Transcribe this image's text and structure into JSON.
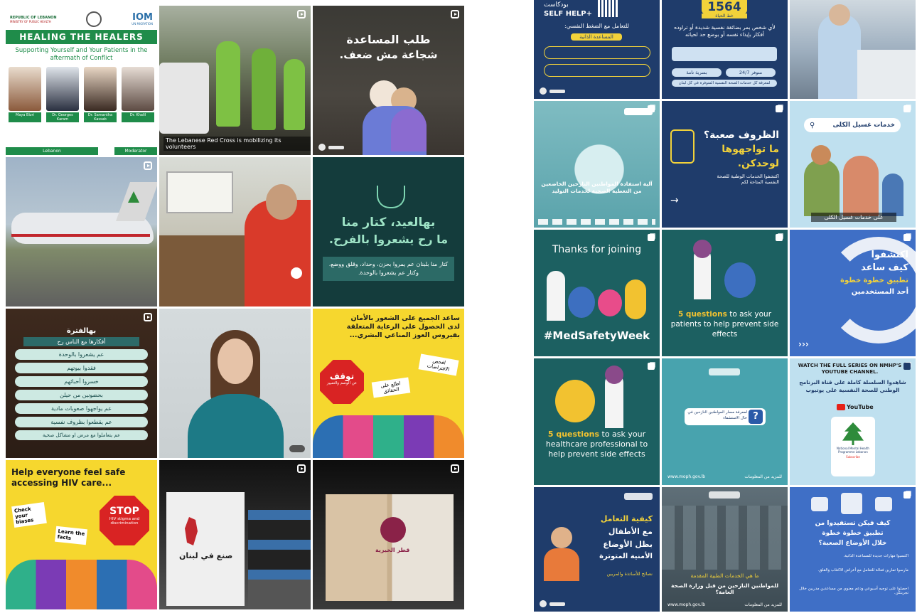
{
  "left": {
    "t1": {
      "org_left": "REPUBLIC OF LEBANON",
      "org_left_sub": "MINISTRY OF PUBLIC HEALTH",
      "org_right": "IOM",
      "org_right_sub": "UN MIGRATION",
      "banner": "HEALING THE HEALERS",
      "subtitle": "Supporting Yourself and Your Patients in the aftermath of Conflict",
      "speakers": [
        "Maya Bizri",
        "Dr. Georges Karam",
        "Dr. Samantha Kassab",
        "Dr. Khalil"
      ],
      "footer_left": "Lebanon",
      "footer_right": "Moderator"
    },
    "t2": {
      "caption": "The Lebanese Red Cross is mobilizing its volunteers"
    },
    "t3": {
      "line1": "طلب المساعدة",
      "line2": "شجاعة مش ضعف."
    },
    "t5": {},
    "t6": {},
    "t7": {
      "line1": "بهالعيد، كتار منا",
      "line2": "ما رح يشعروا بالفرح.",
      "body": "كتار منا بلبنان عم يمروا بحزن، وحداد، وقلق ووضع، وكتار عم يشعروا بالوحدة."
    },
    "t8": {
      "title": "بهالفترة",
      "subtitle": "أفكارها مع الناس رح",
      "items": [
        "عم يشعروا بالوحدة",
        "فقدوا بيوتهم",
        "خسروا أحبائهم",
        "بحضونين من حيلن",
        "عم يواجهوا صعوبات مادية",
        "عم يقطعوا بظروف نفسية",
        "عم يتعاملوا مع مرض او مشاكل صحية"
      ]
    },
    "t9": {},
    "t10": {
      "line1": "ساعد الجميع على الشعور بالأمان",
      "line2": "لدى الحصول على الرعاية المتعلقة",
      "line3": "بفيروس العوز المناعي البشري...",
      "sign1": "توقف",
      "sign1_sub": "عن الوصم والتمييز",
      "sign2": "اطلع على الحقائق",
      "sign3": "افحص الافتراضات"
    },
    "t11": {
      "title_line1": "Help everyone feel safe",
      "title_line2": "accessing HIV care...",
      "sign1": "Check your biases",
      "sign2": "Learn the facts",
      "stop": "STOP",
      "stop_sub": "HIV stigma and discrimination"
    },
    "t12": {
      "box_text": "صنع في لبنان"
    },
    "t13": {
      "box_text": "قطر الخيرية"
    }
  },
  "right": {
    "r1": {
      "title": "SELF HELP+",
      "title_top": "بودكاست",
      "line": "للتعامل مع الضغط النفسي:",
      "pill": "المساعدة الذاتية"
    },
    "r2": {
      "number": "1564",
      "number_sub": "خط الحياة",
      "body": "لأي شخص بمر بضائقة نفسية شديدة أو تراوده أفكار بإيذاء نفسه أو بوضع حد لحياته",
      "pill1": "متوفر 24/7",
      "pill2": "بسرية تامة",
      "footer": "لمعرفة كل خدمات الصحة النفسية المتوفرة في كل لبنان"
    },
    "r4": {
      "body": "آلية استفادة المواطنين النازحين الخاضعين من التغطية الصحية لخدمات التوليد"
    },
    "r5": {
      "line1": "الظروف صعبة؟",
      "line2": "ما تواجهوها",
      "line3": "لوحدكن.",
      "sub": "اكتشفوا الخدمات الوطنية للصحة النفسية المتاحة لكم"
    },
    "r6": {
      "search": "خدمات غسيل الكلى",
      "caption": "على خدمات غسيل الكلى"
    },
    "r7": {
      "top": "Thanks for joining",
      "tag": "#MedSafetyWeek"
    },
    "r8": {
      "hl": "5 questions",
      "rest": "to ask your patients to help prevent side effects"
    },
    "r9": {
      "line1": "اكتشفوا",
      "line2": "كيف ساعد",
      "line3": "تطبيق خطوة خطوة",
      "line4": "أحد المستخدمين"
    },
    "r10": {
      "hl": "5 questions",
      "rest": "to ask your healthcare professional to help prevent side effects"
    },
    "r11": {
      "card": "لمعرفة مسار المواطنين النازحين في حال الاستشفاء",
      "footer_left": "www.moph.gov.lb",
      "footer_right": "للمزيد من المعلومات"
    },
    "r12": {
      "en": "WATCH THE FULL SERIES ON NMHP'S YOUTUBE CHANNEL.",
      "ar": "شاهدوا السلسلة كاملة على قناة البرنامج الوطني للصحة النفسية على يوتيوب",
      "yt": "YouTube",
      "card": "National Mental Health Programme Lebanon",
      "subscribe": "Subscribe"
    },
    "r13": {
      "line1": "كيفية التعامل",
      "line2": "مع الأطفال",
      "line3": "بظل الأوضاع",
      "line4": "الأمنية المتوترة",
      "sub": "نصائح للأساتذة والمربين"
    },
    "r14": {
      "line1": "ما هي الخدمات الطبية المقدمة",
      "line2": "للمواطنين النازحين من قبل وزارة الصحة العامة؟",
      "footer_left": "www.moph.gov.lb",
      "footer_right": "للمزيد من المعلومات"
    },
    "r15": {
      "title1": "كيف فيكن تستفيدوا من",
      "title2": "تطبيق خطوة خطوة",
      "title3": "خلال الأوضاع الصعبة؟",
      "items": [
        "اكتسبوا مهارات جديدة للمساعدة الذاتية.",
        "مارسوا تمارين فعالة للتعامل مع أعراض الاكتئاب والقلق.",
        "احصلوا على توجيه أسبوعي ودعم معنوي من مساعدين مدربين خلال تجربتكن."
      ]
    }
  }
}
